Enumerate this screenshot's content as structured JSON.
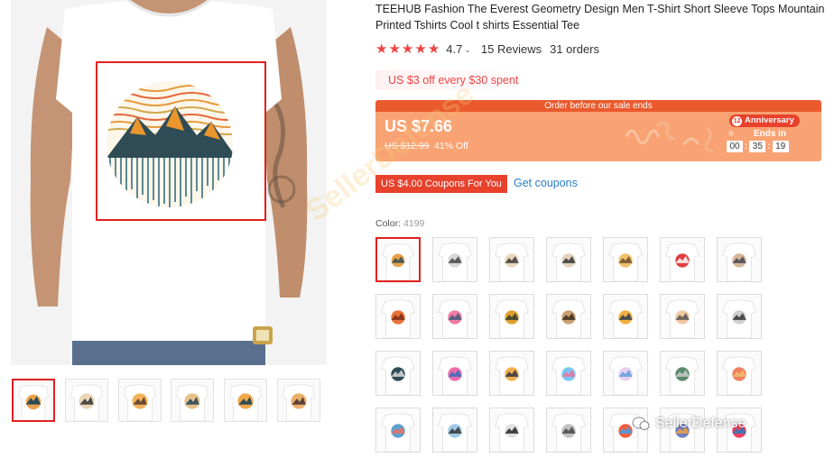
{
  "product": {
    "title": "TEEHUB Fashion The Everest Geometry Design Men T-Shirt Short Sleeve Tops Mountain Printed Tshirts Cool t shirts Essential Tee",
    "rating": "4.7",
    "reviews": "15 Reviews",
    "orders": "31 orders"
  },
  "promo": {
    "text": "US $3 off every $30 spent"
  },
  "sale": {
    "header": "Order before our sale ends",
    "price": "US $7.66",
    "original_price": "US $12.99",
    "discount": "41% Off",
    "badge": "Anniversary",
    "badge_icon": "12",
    "ends_label": "Ends in",
    "timer": {
      "h": "00",
      "m": "35",
      "s": "19"
    }
  },
  "coupon": {
    "tag": "US $4.00 Coupons For You",
    "link": "Get coupons"
  },
  "color": {
    "label": "Color:",
    "value": "4199"
  },
  "watermark": {
    "text": "SellerDefense"
  },
  "brand": {
    "text": "SellerDefense"
  },
  "colors": {
    "accent_red": "#e02020",
    "star_red": "#f04343",
    "sale_header": "#ea5a2d",
    "sale_body": "#f9a273",
    "link_blue": "#2a7dc5"
  }
}
